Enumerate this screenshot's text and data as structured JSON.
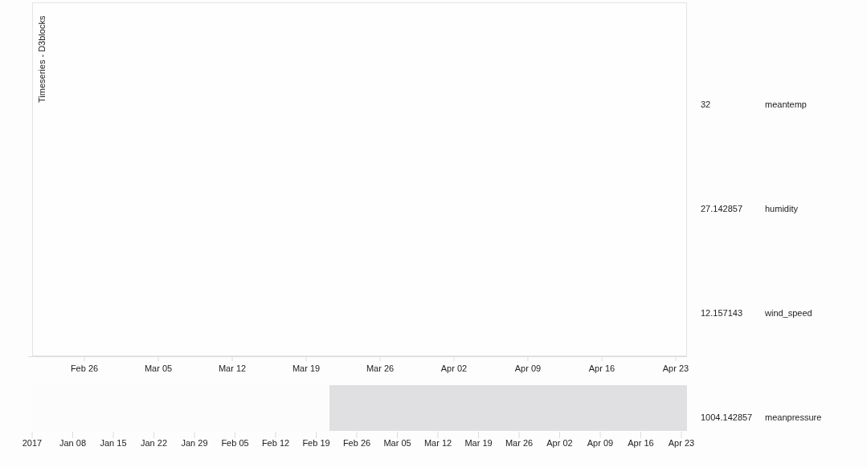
{
  "chart": {
    "title": "Timeseries - D3blocks",
    "main_axis_ticks": [
      "Feb 26",
      "Mar 05",
      "Mar 12",
      "Mar 19",
      "Mar 26",
      "Apr 02",
      "Apr 09",
      "Apr 16",
      "Apr 23"
    ],
    "overview_axis_ticks": [
      "2017",
      "Jan 08",
      "Jan 15",
      "Jan 22",
      "Jan 29",
      "Feb 05",
      "Feb 12",
      "Feb 19",
      "Feb 26",
      "Mar 05",
      "Mar 12",
      "Mar 19",
      "Mar 26",
      "Apr 02",
      "Apr 09",
      "Apr 16",
      "Apr 23"
    ]
  },
  "legend": [
    {
      "value": "32",
      "name": "meantemp"
    },
    {
      "value": "27.142857",
      "name": "humidity"
    },
    {
      "value": "12.157143",
      "name": "wind_speed"
    },
    {
      "value": "1004.142857",
      "name": "meanpressure"
    }
  ]
}
